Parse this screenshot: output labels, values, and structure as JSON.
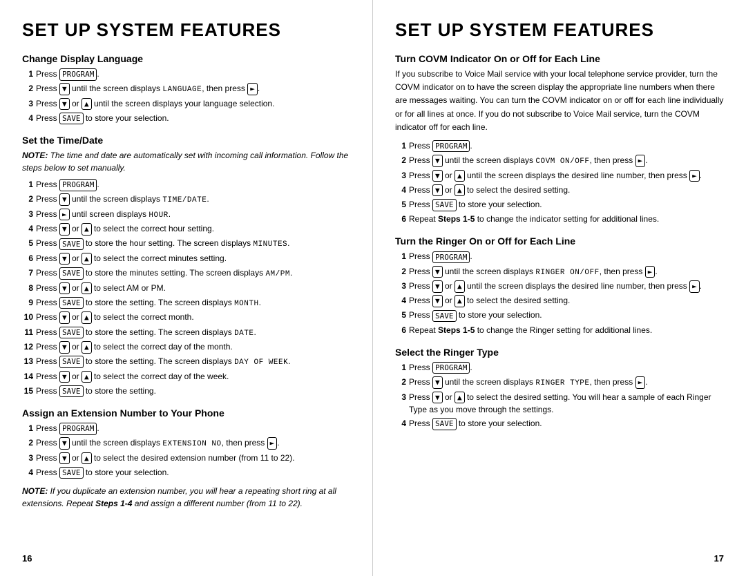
{
  "left": {
    "title": "SET UP SYSTEM FEATURES",
    "sections": [
      {
        "id": "change-display-language",
        "title": "Change Display Language",
        "steps": [
          {
            "num": "1",
            "text": "Press",
            "key": "PROGRAM",
            "after": "."
          },
          {
            "num": "2",
            "text": "Press",
            "key": "▼",
            "after": " until the screen displays ",
            "mono": "LANGUAGE",
            "end": ", then press",
            "key2": "►",
            "end2": "."
          },
          {
            "num": "3",
            "text": "Press",
            "key": "▼",
            "mid": " or ",
            "key2": "▲",
            "after": " until the screen displays your language selection."
          },
          {
            "num": "4",
            "text": "Press",
            "key": "SAVE",
            "after": " to store your selection."
          }
        ]
      },
      {
        "id": "set-time-date",
        "title": "Set the Time/Date",
        "note": "NOTE:  The time and date are automatically set with incoming call information. Follow the steps below to set manually.",
        "steps": [
          {
            "num": "1",
            "html": "Press <kbd>PROGRAM</kbd>."
          },
          {
            "num": "2",
            "html": "Press <kbd>▼</kbd> until the screen displays <span class='monospace'>TIME/DATE</span>."
          },
          {
            "num": "3",
            "html": "Press <kbd>►</kbd> until screen displays <span class='monospace'>HOUR</span>."
          },
          {
            "num": "4",
            "html": "Press <kbd>▼</kbd> or <kbd>▲</kbd> to select the correct hour setting."
          },
          {
            "num": "5",
            "html": "Press <kbd>SAVE</kbd> to store the hour setting. The screen displays <span class='monospace'>MINUTES</span>."
          },
          {
            "num": "6",
            "html": "Press <kbd>▼</kbd> or <kbd>▲</kbd> to select the correct minutes setting."
          },
          {
            "num": "7",
            "html": "Press <kbd>SAVE</kbd> to store the minutes setting. The screen displays <span class='monospace'>AM/PM</span>."
          },
          {
            "num": "8",
            "html": "Press <kbd>▼</kbd> or <kbd>▲</kbd> to select AM or PM."
          },
          {
            "num": "9",
            "html": "Press <kbd>SAVE</kbd> to store the setting. The screen displays <span class='monospace'>MONTH</span>."
          },
          {
            "num": "10",
            "html": "Press <kbd>▼</kbd> or <kbd>▲</kbd> to select the correct month."
          },
          {
            "num": "11",
            "html": "Press <kbd>SAVE</kbd> to store the setting. The screen displays <span class='monospace'>DATE</span>."
          },
          {
            "num": "12",
            "html": "Press <kbd>▼</kbd> or <kbd>▲</kbd> to select the correct day of the month."
          },
          {
            "num": "13",
            "html": "Press <kbd>SAVE</kbd> to store the setting. The screen displays <span class='monospace'>DAY OF WEEK</span>."
          },
          {
            "num": "14",
            "html": "Press <kbd>▼</kbd> or <kbd>▲</kbd> to select the correct day of the week."
          },
          {
            "num": "15",
            "html": "Press <kbd>SAVE</kbd> to store the setting."
          }
        ]
      },
      {
        "id": "assign-extension",
        "title": "Assign an Extension Number to Your Phone",
        "steps": [
          {
            "num": "1",
            "html": "Press <kbd>PROGRAM</kbd>."
          },
          {
            "num": "2",
            "html": "Press <kbd>▼</kbd> until the screen displays <span class='monospace'>EXTENSION NO</span>, then press <kbd>►</kbd>."
          },
          {
            "num": "3",
            "html": "Press <kbd>▼</kbd> or <kbd>▲</kbd> to select the desired extension number (from 11 to 22)."
          },
          {
            "num": "4",
            "html": "Press <kbd>SAVE</kbd> to store your selection."
          }
        ],
        "note2": "<b><i>NOTE:</i></b><i>  If you duplicate an extension number, you will hear a repeating short ring at all extensions.  Repeat <b>Steps 1-4</b> and assign a different number (from 11 to 22).</i>"
      }
    ],
    "page_number": "16"
  },
  "right": {
    "title": "SET UP SYSTEM FEATURES",
    "sections": [
      {
        "id": "turn-covm-indicator",
        "title": "Turn COVM Indicator On or Off for Each Line",
        "description": "If you subscribe to Voice Mail service with your local telephone service provider, turn the COVM indicator on to have the screen display the appropriate line numbers when there are messages waiting. You can turn the COVM indicator on or off for each line individually or for all lines at once.  If you do not subscribe to Voice Mail service, turn the COVM indicator off for each line.",
        "steps": [
          {
            "num": "1",
            "html": "Press <kbd>PROGRAM</kbd>."
          },
          {
            "num": "2",
            "html": "Press <kbd>▼</kbd> until the screen displays <span class='monospace'>COVM ON/OFF</span>, then press <kbd>►</kbd>."
          },
          {
            "num": "3",
            "html": "Press <kbd>▼</kbd> or <kbd>▲</kbd> until the screen displays the desired line number, then press <kbd>►</kbd>."
          },
          {
            "num": "4",
            "html": "Press <kbd>▼</kbd> or <kbd>▲</kbd> to select the desired setting."
          },
          {
            "num": "5",
            "html": "Press <kbd>SAVE</kbd> to store your selection."
          },
          {
            "num": "6",
            "html": "Repeat <b>Steps 1-5</b> to change the indicator setting for additional lines."
          }
        ]
      },
      {
        "id": "turn-ringer-on-off",
        "title": "Turn the Ringer On or Off for Each Line",
        "steps": [
          {
            "num": "1",
            "html": "Press <kbd>PROGRAM</kbd>."
          },
          {
            "num": "2",
            "html": "Press <kbd>▼</kbd> until the screen displays <span class='monospace'>RINGER ON/OFF</span>, then press <kbd>►</kbd>."
          },
          {
            "num": "3",
            "html": "Press <kbd>▼</kbd> or <kbd>▲</kbd> until the screen displays the desired line number, then press <kbd>►</kbd>."
          },
          {
            "num": "4",
            "html": "Press <kbd>▼</kbd> or <kbd>▲</kbd> to select the desired setting."
          },
          {
            "num": "5",
            "html": "Press <kbd>SAVE</kbd> to store your selection."
          },
          {
            "num": "6",
            "html": "Repeat <b>Steps 1-5</b> to change the Ringer setting for additional lines."
          }
        ]
      },
      {
        "id": "select-ringer-type",
        "title": "Select the Ringer Type",
        "steps": [
          {
            "num": "1",
            "html": "Press <kbd>PROGRAM</kbd>."
          },
          {
            "num": "2",
            "html": "Press <kbd>▼</kbd> until the screen displays <span class='monospace'>RINGER TYPE</span>, then press <kbd>►</kbd>."
          },
          {
            "num": "3",
            "html": "Press <kbd>▼</kbd> or <kbd>▲</kbd> to select the desired setting. You will hear a sample of each Ringer Type as you move through the settings."
          },
          {
            "num": "4",
            "html": "Press <kbd>SAVE</kbd> to store your selection."
          }
        ]
      }
    ],
    "page_number": "17"
  }
}
